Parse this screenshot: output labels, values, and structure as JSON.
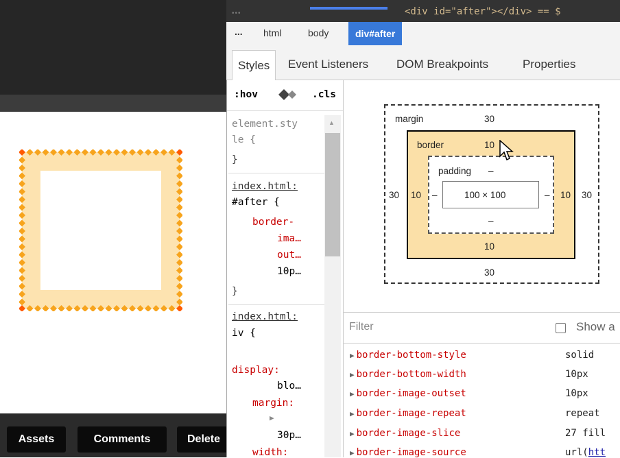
{
  "page_preview": {
    "buttons": [
      {
        "label": "Assets"
      },
      {
        "label": "Comments"
      },
      {
        "label": "Delete"
      }
    ],
    "colors": {
      "border_diamond": "#f7a41d",
      "corner_diamond": "#ff5a00",
      "fill": "#fde3b0"
    }
  },
  "devtools": {
    "selected_node": "<div id=\"after\"></div> == $",
    "breadcrumbs": {
      "ellipsis": "...",
      "items": [
        "html",
        "body"
      ],
      "active": "div#after"
    },
    "tabs": [
      "Styles",
      "Event Listeners",
      "DOM Breakpoints",
      "Properties"
    ],
    "styles_pane": {
      "toolbar": {
        "hov": ":hov",
        "cls": ".cls"
      },
      "rules": [
        {
          "selector_lines": [
            "element.sty",
            "le {"
          ],
          "close": "}"
        },
        {
          "source": "index.html:",
          "selector": "#after {",
          "property": "border-",
          "value_lines": [
            "ima…",
            "out…",
            "10p…"
          ],
          "close": "}"
        },
        {
          "source": "index.html:",
          "selector": "iv {",
          "declarations": [
            {
              "name": "display:",
              "value": "blo…"
            },
            {
              "name": "margin:",
              "value": "30p…",
              "expander": "▶"
            },
            {
              "name": "width:"
            }
          ]
        }
      ]
    },
    "box_model": {
      "margin": {
        "label": "margin",
        "top": "30",
        "right": "30",
        "bottom": "30",
        "left": "30"
      },
      "border": {
        "label": "border",
        "top": "10",
        "right": "10",
        "bottom": "10",
        "left": "10"
      },
      "padding": {
        "label": "padding",
        "top": "–",
        "right": "–",
        "bottom": "–",
        "left": "–"
      },
      "content": "100 × 100"
    },
    "computed": {
      "filter_placeholder": "Filter",
      "show_all_label": "Show a",
      "properties": [
        {
          "name": "border-bottom-style",
          "value": "solid"
        },
        {
          "name": "border-bottom-width",
          "value": "10px"
        },
        {
          "name": "border-image-outset",
          "value": "10px"
        },
        {
          "name": "border-image-repeat",
          "value": "repeat"
        },
        {
          "name": "border-image-slice",
          "value": "27 fill"
        },
        {
          "name": "border-image-source",
          "value_prefix": "url(",
          "value_link": "htt"
        }
      ]
    }
  }
}
